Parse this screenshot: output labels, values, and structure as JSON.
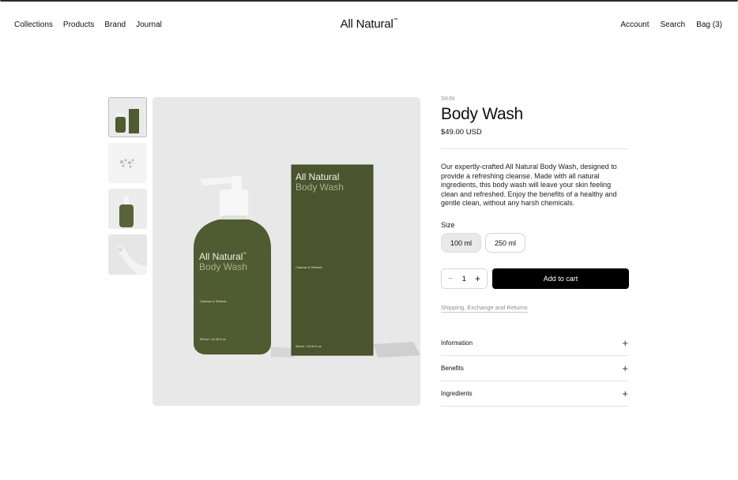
{
  "header": {
    "nav_left": [
      "Collections",
      "Products",
      "Brand",
      "Journal"
    ],
    "logo": "All Natural",
    "logo_mark": "™",
    "nav_right": [
      "Account",
      "Search",
      "Bag (3)"
    ]
  },
  "gallery": {
    "thumbnails": [
      "product-set-thumbnail",
      "flowers-thumbnail",
      "bottle-thumbnail",
      "hand-thumbnail"
    ],
    "main_image": {
      "bottle_brand": "All Natural",
      "bottle_mark": "™",
      "bottle_product": "Body Wash",
      "bottle_subtext": "Cleanse & Refresh",
      "bottle_volume": "500ml / 16.90 fl oz",
      "box_brand": "All Natural",
      "box_product": "Body Wash",
      "box_subtext": "Cleanse & Refresh",
      "box_volume": "500ml / 16.90 fl oz"
    }
  },
  "product": {
    "category": "SKIN",
    "title": "Body Wash",
    "price": "$49.00 USD",
    "description": "Our expertly-crafted All Natural Body Wash, designed to provide a refreshing cleanse. Made with all natural ingredients, this body wash will leave your skin feeling clean and refreshed. Enjoy the benefits of a healthy and gentle clean, without any harsh chemicals.",
    "size_label": "Size",
    "sizes": [
      "100 ml",
      "250 ml"
    ],
    "selected_size": "100 ml",
    "quantity": "1",
    "minus": "−",
    "plus": "+",
    "add_to_cart": "Add to cart",
    "shipping_link": "Shipping, Exchange and Returns",
    "accordions": [
      "Information",
      "Benefits",
      "Ingredients"
    ],
    "accordion_icon": "+"
  },
  "colors": {
    "bottle_green": "#4f5b31",
    "button_black": "#000000",
    "image_bg": "#e8e8e8"
  }
}
